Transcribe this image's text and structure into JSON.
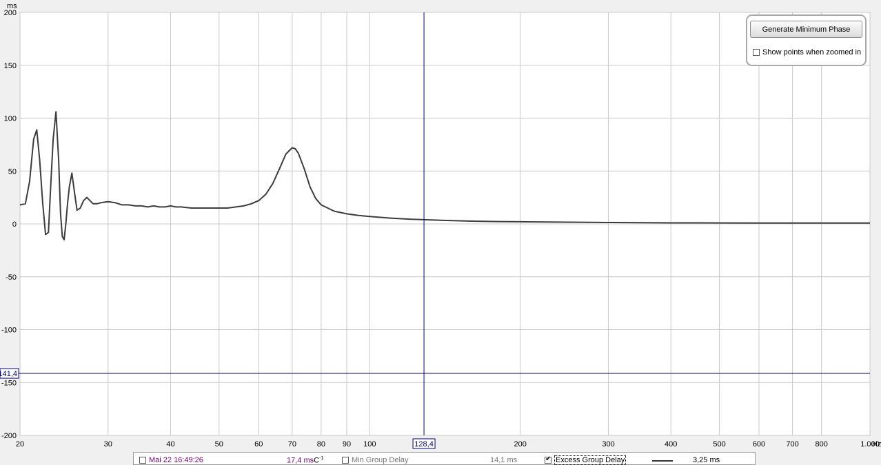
{
  "colors": {
    "plot_bg": "#ffffff",
    "grid": "#c8c8c8",
    "trace": "#3c3c3c",
    "cursor": "#000080",
    "legend_time": "#800080",
    "disabled": "#777777"
  },
  "chart_data": {
    "type": "line",
    "x_scale": "log",
    "y_unit_label": "ms",
    "x_unit_label": "Hz",
    "xlim": [
      20,
      1000
    ],
    "ylim": [
      -200,
      200
    ],
    "grid": true,
    "y_ticks": [
      "200",
      "150",
      "100",
      "50",
      "0",
      "-50",
      "-100",
      "-150",
      "-200"
    ],
    "x_ticks": [
      {
        "v": 20,
        "label": "20"
      },
      {
        "v": 30,
        "label": "30"
      },
      {
        "v": 40,
        "label": "40"
      },
      {
        "v": 50,
        "label": "50"
      },
      {
        "v": 60,
        "label": "60"
      },
      {
        "v": 70,
        "label": "70"
      },
      {
        "v": 80,
        "label": "80"
      },
      {
        "v": 90,
        "label": "90"
      },
      {
        "v": 100,
        "label": "100"
      },
      {
        "v": 200,
        "label": "200"
      },
      {
        "v": 300,
        "label": "300"
      },
      {
        "v": 400,
        "label": "400"
      },
      {
        "v": 500,
        "label": "500"
      },
      {
        "v": 600,
        "label": "600"
      },
      {
        "v": 700,
        "label": "700"
      },
      {
        "v": 800,
        "label": "800"
      },
      {
        "v": 1000,
        "label": "1.000"
      }
    ],
    "cursor": {
      "x": 128.4,
      "x_label": "128,4",
      "y": -141.4,
      "y_label": "141,4"
    },
    "series": [
      {
        "x": [
          20,
          20.5,
          20.9,
          21.3,
          21.6,
          21.9,
          22.2,
          22.5,
          22.8,
          23.0,
          23.3,
          23.6,
          23.9,
          24.1,
          24.3,
          24.5,
          24.7,
          24.9,
          25.1,
          25.4,
          25.7,
          26.0,
          26.4,
          26.8,
          27.2,
          27.6,
          28.0,
          28.5,
          29,
          30,
          31,
          32,
          33,
          34,
          35,
          36,
          37,
          38,
          39,
          40,
          41,
          42,
          44,
          46,
          48,
          50,
          52,
          54,
          56,
          58,
          60,
          62,
          64,
          66,
          68,
          70,
          71,
          72,
          74,
          76,
          78,
          80,
          85,
          90,
          95,
          100,
          110,
          120,
          128.4,
          140,
          160,
          180,
          200,
          250,
          300,
          400,
          500,
          600,
          700,
          800,
          900,
          1000
        ],
        "y": [
          18,
          19,
          40,
          80,
          89,
          60,
          20,
          -10,
          -8,
          30,
          80,
          106,
          60,
          10,
          -12,
          -15,
          0,
          20,
          35,
          48,
          30,
          13,
          15,
          22,
          25,
          22,
          19,
          19,
          20,
          21,
          20,
          18,
          18,
          17,
          17,
          16,
          17,
          16,
          16,
          17,
          16,
          16,
          15,
          15,
          15,
          15,
          15,
          16,
          17,
          19,
          22,
          28,
          38,
          52,
          66,
          72,
          71,
          67,
          52,
          35,
          24,
          18,
          12,
          9.5,
          8,
          7,
          5.5,
          4.5,
          4,
          3.3,
          2.6,
          2.2,
          2,
          1.6,
          1.3,
          1,
          0.9,
          0.8,
          0.8,
          0.8,
          0.8,
          0.8
        ]
      }
    ]
  },
  "panel": {
    "button_label": "Generate Minimum Phase",
    "checkbox_label": "Show points when zoomed in"
  },
  "legend": {
    "measurement_name": "Mai 22 16:49:26",
    "measurement_value": "17,4 ms",
    "measurement_suffix": "C",
    "measurement_suffix_sup": "-1",
    "min_label": "Min Group Delay",
    "min_value": "14,1 ms",
    "excess_label": "Excess Group Delay",
    "excess_value": "3,25 ms"
  }
}
